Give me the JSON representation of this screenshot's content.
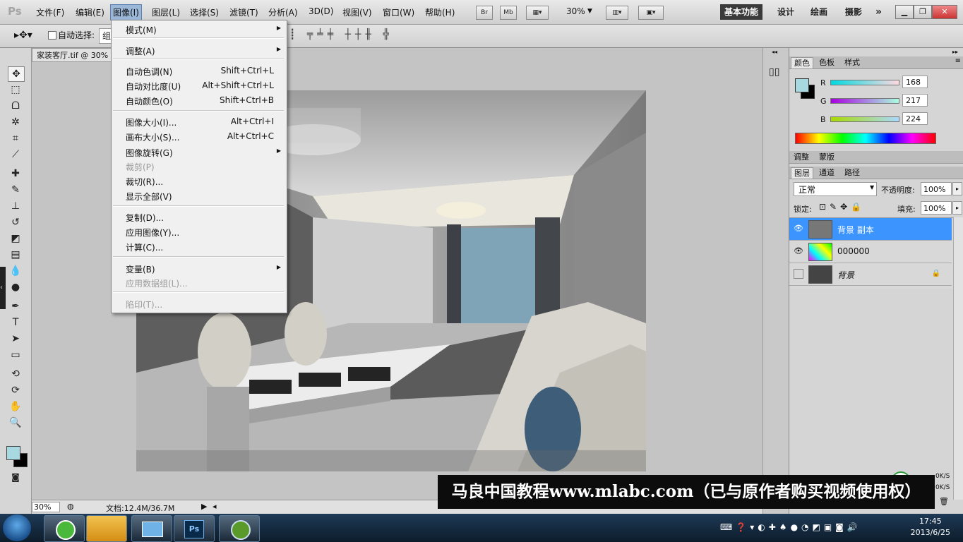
{
  "menubar": {
    "logo": "Ps",
    "items": [
      "文件(F)",
      "编辑(E)",
      "图像(I)",
      "图层(L)",
      "选择(S)",
      "滤镜(T)",
      "分析(A)",
      "3D(D)",
      "视图(V)",
      "窗口(W)",
      "帮助(H)"
    ],
    "bridge": "Br",
    "minibridge": "Mb",
    "zoom": "30%",
    "workspaces": [
      "基本功能",
      "设计",
      "绘画",
      "摄影"
    ],
    "more": "»"
  },
  "options_bar": {
    "auto_select_label": "自动选择:",
    "auto_select_value": "组"
  },
  "document": {
    "tab_title": "家装客厅.tif @ 30%",
    "status_zoom": "30%",
    "status_doc": "文档:12.4M/36.7M"
  },
  "image_menu": {
    "groups": [
      [
        {
          "label": "模式(M)",
          "sub": true
        }
      ],
      [
        {
          "label": "调整(A)",
          "sub": true
        }
      ],
      [
        {
          "label": "自动色调(N)",
          "shortcut": "Shift+Ctrl+L"
        },
        {
          "label": "自动对比度(U)",
          "shortcut": "Alt+Shift+Ctrl+L"
        },
        {
          "label": "自动颜色(O)",
          "shortcut": "Shift+Ctrl+B"
        }
      ],
      [
        {
          "label": "图像大小(I)...",
          "shortcut": "Alt+Ctrl+I"
        },
        {
          "label": "画布大小(S)...",
          "shortcut": "Alt+Ctrl+C"
        },
        {
          "label": "图像旋转(G)",
          "sub": true
        },
        {
          "label": "裁剪(P)",
          "disabled": true
        },
        {
          "label": "裁切(R)..."
        },
        {
          "label": "显示全部(V)"
        }
      ],
      [
        {
          "label": "复制(D)..."
        },
        {
          "label": "应用图像(Y)..."
        },
        {
          "label": "计算(C)..."
        }
      ],
      [
        {
          "label": "变量(B)",
          "sub": true
        },
        {
          "label": "应用数据组(L)...",
          "disabled": true
        }
      ],
      [
        {
          "label": "陷印(T)...",
          "disabled": true
        }
      ]
    ]
  },
  "color_panel": {
    "tabs": [
      "颜色",
      "色板",
      "样式"
    ],
    "r_label": "R",
    "r": "168",
    "g_label": "G",
    "g": "217",
    "b_label": "B",
    "b": "224",
    "foreground": "#a8d9e0",
    "background": "#000000"
  },
  "adjust_panel": {
    "tabs": [
      "调整",
      "蒙版"
    ]
  },
  "layers_panel": {
    "tabs": [
      "图层",
      "通道",
      "路径"
    ],
    "blend_mode": "正常",
    "opacity_label": "不透明度:",
    "opacity": "100%",
    "lock_label": "锁定:",
    "fill_label": "填充:",
    "fill": "100%",
    "layers": [
      {
        "name": "背景 副本",
        "selected": true,
        "visible": true
      },
      {
        "name": "000000",
        "selected": false,
        "visible": true
      },
      {
        "name": "背景",
        "selected": false,
        "visible": false
      }
    ]
  },
  "net_speed": {
    "up": "0K/S",
    "down": "0K/S"
  },
  "watermark": "马良中国教程www.mlabc.com（已与原作者购买视频使用权）",
  "taskbar": {
    "time": "17:45",
    "date": "2013/6/25"
  }
}
